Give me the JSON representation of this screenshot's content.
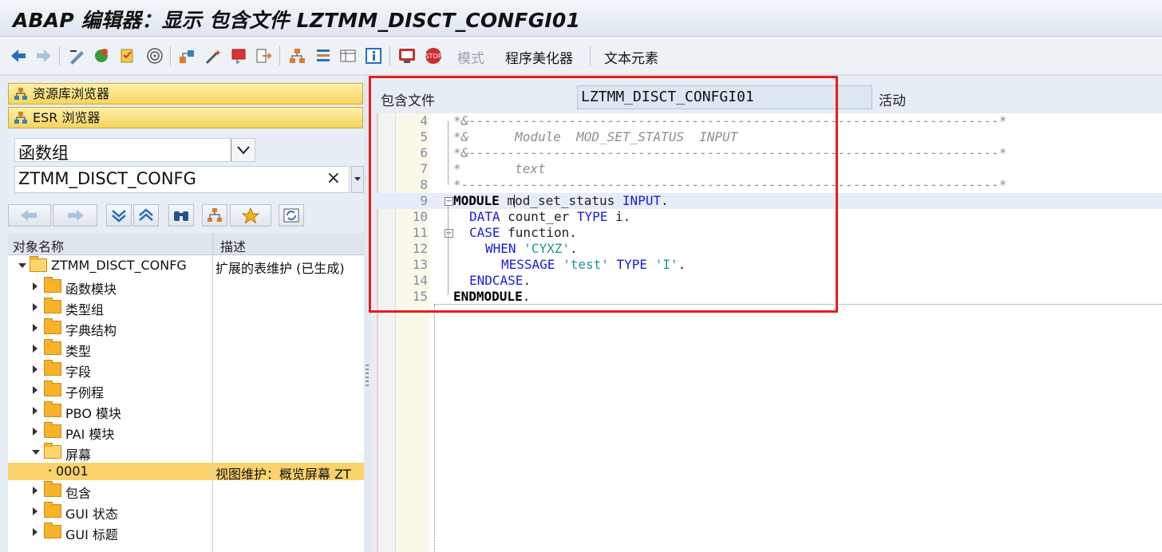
{
  "window": {
    "title": "ABAP 编辑器：显示 包含文件 LZTMM_DISCT_CONFGI01"
  },
  "toolbar": {
    "mode_label": "模式",
    "pretty_printer_label": "程序美化器",
    "text_elements_label": "文本元素"
  },
  "left_panel": {
    "repo_browser_label": "资源库浏览器",
    "esr_browser_label": "ESR 浏览器",
    "object_type_value": "函数组",
    "object_name_value": "ZTMM_DISCT_CONFG",
    "clear_symbol": "×",
    "tree": {
      "col_name": "对象名称",
      "col_desc": "描述",
      "rows": [
        {
          "label": "ZTMM_DISCT_CONFG",
          "desc": "扩展的表维护 (已生成)"
        },
        {
          "label": "函数模块",
          "desc": ""
        },
        {
          "label": "类型组",
          "desc": ""
        },
        {
          "label": "字典结构",
          "desc": ""
        },
        {
          "label": "类型",
          "desc": ""
        },
        {
          "label": "字段",
          "desc": ""
        },
        {
          "label": "子例程",
          "desc": ""
        },
        {
          "label": "PBO 模块",
          "desc": ""
        },
        {
          "label": "PAI 模块",
          "desc": ""
        },
        {
          "label": "屏幕",
          "desc": ""
        },
        {
          "label": "0001",
          "desc": "视图维护：概览屏幕 ZT"
        },
        {
          "label": "包含",
          "desc": ""
        },
        {
          "label": "GUI 状态",
          "desc": ""
        },
        {
          "label": "GUI 标题",
          "desc": ""
        }
      ]
    }
  },
  "editor": {
    "include_label": "包含文件",
    "include_name": "LZTMM_DISCT_CONFGI01",
    "status": "活动",
    "lines": [
      {
        "num": "4",
        "text": "*&---------------------------------------------------------------------*"
      },
      {
        "num": "5",
        "text": "*&      Module  MOD_SET_STATUS  INPUT"
      },
      {
        "num": "6",
        "text": "*&---------------------------------------------------------------------*"
      },
      {
        "num": "7",
        "text": "*       text"
      },
      {
        "num": "8",
        "text": "*----------------------------------------------------------------------*"
      },
      {
        "num": "9",
        "kw1": "MODULE",
        "rest1": " mod_set_status ",
        "kw2": "INPUT",
        "rest2": "."
      },
      {
        "num": "10",
        "kw1": "DATA",
        "rest1": " count_er ",
        "kw2": "TYPE",
        "rest2": " i."
      },
      {
        "num": "11",
        "kw1": "CASE",
        "rest1": " function."
      },
      {
        "num": "12",
        "kw1": "WHEN",
        "str1": "'CYXZ'",
        "rest1": "."
      },
      {
        "num": "13",
        "kw1": "MESSAGE",
        "str1": "'test'",
        "kw2": "TYPE",
        "str2": "'I'",
        "rest1": "."
      },
      {
        "num": "14",
        "kw1": "ENDCASE",
        "rest1": "."
      },
      {
        "num": "15",
        "kw1": "ENDMODULE",
        "rest1": "."
      }
    ]
  }
}
